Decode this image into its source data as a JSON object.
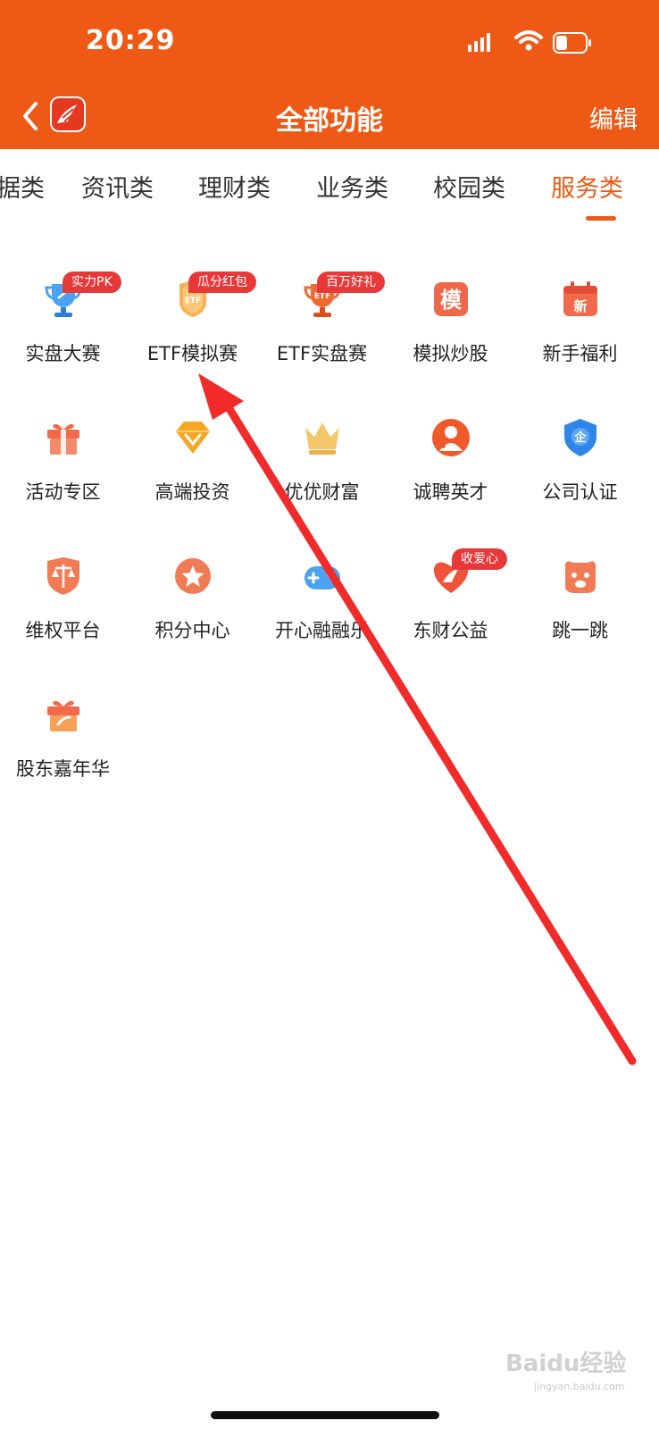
{
  "status_bar": {
    "time": "20:29"
  },
  "header": {
    "title": "全部功能",
    "edit_label": "编辑"
  },
  "tabs": [
    "据类",
    "资讯类",
    "理财类",
    "业务类",
    "校园类",
    "服务类"
  ],
  "active_tab": "服务类",
  "icon_badge_text": {
    "etf": "ETF",
    "mo": "模",
    "xin": "新",
    "qi": "企"
  },
  "items": [
    {
      "label": "实盘大赛",
      "badge": "实力PK",
      "icon": "trophy-icon"
    },
    {
      "label": "ETF模拟赛",
      "badge": "瓜分红包",
      "icon": "etf-medal-icon"
    },
    {
      "label": "ETF实盘赛",
      "badge": "百万好礼",
      "icon": "etf-trophy-icon"
    },
    {
      "label": "模拟炒股",
      "icon": "simulate-stock-icon"
    },
    {
      "label": "新手福利",
      "icon": "calendar-gift-icon"
    },
    {
      "label": "活动专区",
      "icon": "gift-box-icon"
    },
    {
      "label": "高端投资",
      "icon": "diamond-icon"
    },
    {
      "label": "优优财富",
      "icon": "crown-icon"
    },
    {
      "label": "诚聘英才",
      "icon": "recruit-icon"
    },
    {
      "label": "公司认证",
      "icon": "shield-icon"
    },
    {
      "label": "维权平台",
      "icon": "scales-icon"
    },
    {
      "label": "积分中心",
      "icon": "star-coin-icon"
    },
    {
      "label": "开心融融乐",
      "icon": "gamepad-icon"
    },
    {
      "label": "东财公益",
      "badge": "收爱心",
      "icon": "heart-icon"
    },
    {
      "label": "跳一跳",
      "icon": "jump-icon"
    },
    {
      "label": "股东嘉年华",
      "icon": "carnival-gift-icon"
    }
  ],
  "colors": {
    "brand": "#ee5a16",
    "badge": "#e8393a",
    "arrow": "#f12a2a"
  },
  "watermark": {
    "text": "Baidu经验",
    "sub": "jingyan.baidu.com"
  }
}
